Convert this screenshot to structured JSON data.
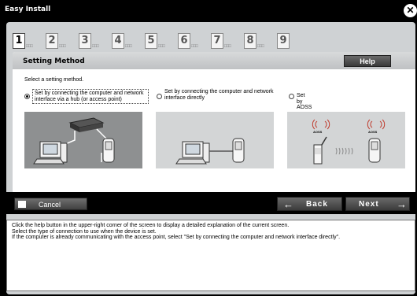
{
  "window": {
    "title": "Easy Install",
    "close_icon": "close-icon"
  },
  "steps": [
    "1",
    "2",
    "3",
    "4",
    "5",
    "6",
    "7",
    "8",
    "9"
  ],
  "active_step": 1,
  "panel": {
    "title": "Setting Method",
    "help_label": "Help",
    "instruction": "Select a setting method."
  },
  "options": [
    {
      "label": "Set by connecting the computer and network interface via a hub (or access point)",
      "selected": true
    },
    {
      "label": "Set by connecting the computer and network interface directly",
      "selected": false
    },
    {
      "label": "Set by AOSS",
      "selected": false
    }
  ],
  "aoss_badge": "AOSS",
  "buttons": {
    "cancel": "Cancel",
    "back": "Back",
    "next": "Next"
  },
  "description": [
    "Click the help button in the upper-right corner of the screen to display a detailed explanation of the current screen.",
    "Select the type of connection to use when the device is set.",
    "If the computer is already communicating with the access point, select \"Set by connecting the computer and network interface directly\"."
  ],
  "colors": {
    "selected_option_bg": "#8e9091",
    "option_bg": "#d3d5d6",
    "bar": "#000000"
  }
}
